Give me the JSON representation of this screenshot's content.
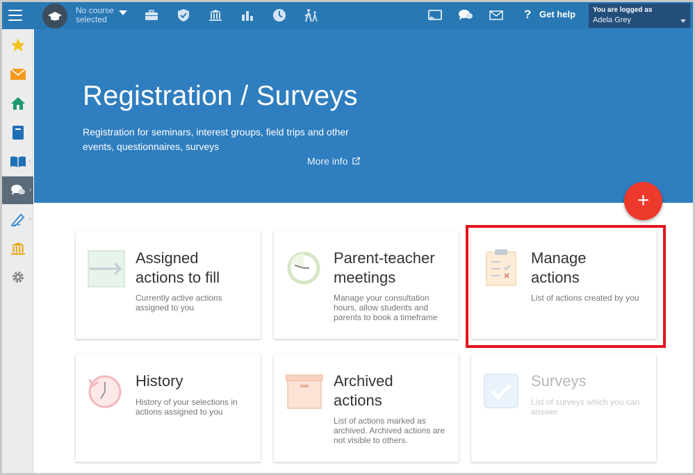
{
  "topbar": {
    "course_line1": "No course",
    "course_line2": "selected",
    "help_label": "Get help",
    "user_label": "You are logged as",
    "user_name": "Adela Grey"
  },
  "hero": {
    "title": "Registration / Surveys",
    "desc_line1": "Registration for seminars, interest groups, field trips and other",
    "desc_line2": "events, questionnaires, surveys",
    "more_info": "More info"
  },
  "fab_label": "+",
  "cards": [
    {
      "title_l1": "Assigned",
      "title_l2": "actions to fill",
      "sub": [
        "Currently active actions",
        "assigned to you"
      ]
    },
    {
      "title_l1": "Parent-teacher",
      "title_l2": "meetings",
      "sub": [
        "Manage your consultation",
        "hours, allow students and",
        "parents to book a timeframe"
      ]
    },
    {
      "title_l1": "Manage",
      "title_l2": "actions",
      "sub": [
        "List of actions created by you"
      ]
    },
    {
      "title_l1": "History",
      "sub": [
        "History of your selections in",
        "actions assigned to you"
      ]
    },
    {
      "title_l1": "Archived",
      "title_l2": "actions",
      "sub": [
        "List of actions marked as",
        "archived. Archived actions are",
        "not visible to others."
      ]
    },
    {
      "title_l1": "Surveys",
      "sub": [
        "List of surveys which you can",
        "answer"
      ]
    }
  ],
  "colors": {
    "topbar": "#2878b4",
    "hero": "#2f7ebf",
    "fab": "#ee3a2c",
    "highlight": "#e3141d"
  }
}
